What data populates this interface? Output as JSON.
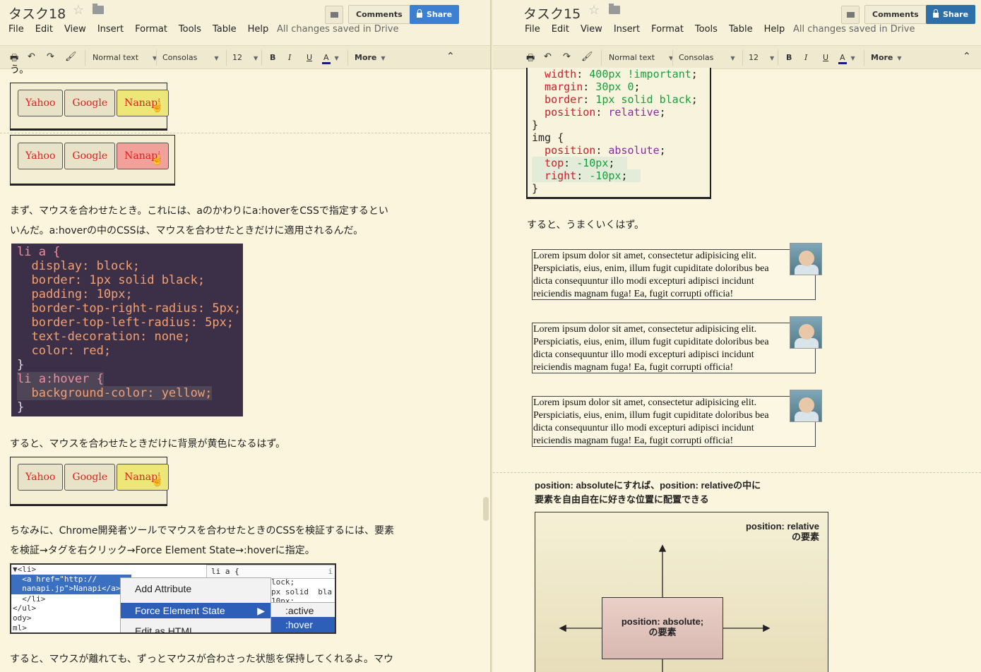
{
  "left": {
    "title": "タスク18",
    "menu": [
      "File",
      "Edit",
      "View",
      "Insert",
      "Format",
      "Tools",
      "Table",
      "Help"
    ],
    "saved": "All changes saved in Drive",
    "comments": "Comments",
    "share": "Share",
    "toolbar": {
      "style": "Normal text",
      "font": "Consolas",
      "size": "12",
      "bold": "B",
      "italic": "I",
      "underline": "U",
      "fontcolor": "A",
      "more": "More"
    },
    "nav_labels": [
      "Yahoo",
      "Google",
      "Nanapi"
    ],
    "para_top": "う。",
    "para1_line1": "まず、マウスを合わせたとき。これには、aのかわりにa:hoverをCSSで指定するとい",
    "para1_line2": "いんだ。a:hoverの中のCSSは、マウスを合わせたときだけに適用されるんだ。",
    "code": [
      "li a {",
      "  display: block;",
      "  border: 1px solid black;",
      "  padding: 10px;",
      "  border-top-right-radius: 5px;",
      "  border-top-left-radius: 5px;",
      "  text-decoration: none;",
      "  color: red;",
      "}",
      "li a:hover {",
      "  background-color: yellow;",
      "}"
    ],
    "para2": "すると、マウスを合わせたときだけに背景が黄色になるはず。",
    "para3_line1": "ちなみに、Chrome開発者ツールでマウスを合わせたときのCSSを検証するには、要素",
    "para3_line2": "を検証→タグを右クリック→Force Element State→:hoverに指定。",
    "devtools": {
      "lines": [
        "▼<li>",
        "  <a href=\"http://",
        "  nanapi.jp\">Nanapi</a>",
        "  </li>",
        "</ul>",
        "ody>",
        "ml>"
      ],
      "styles_head": "li a {",
      "styles_lines": [
        "lock;",
        "px solid  bla",
        "10px;"
      ],
      "context_menu": [
        "Add Attribute",
        "Force Element State",
        "Edit as HTML"
      ],
      "submenu": [
        ":active",
        ":hover"
      ],
      "corner": "i"
    },
    "para4": "すると、マウスが離れても、ずっとマウスが合わさった状態を保持してくれるよ。マウ"
  },
  "right": {
    "title": "タスク15",
    "menu": [
      "File",
      "Edit",
      "View",
      "Insert",
      "Format",
      "Tools",
      "Table",
      "Help"
    ],
    "saved": "All changes saved in Drive",
    "comments": "Comments",
    "share": "Share",
    "toolbar": {
      "style": "Normal text",
      "font": "Consolas",
      "size": "12",
      "bold": "B",
      "italic": "I",
      "underline": "U",
      "fontcolor": "A",
      "more": "More"
    },
    "code": [
      {
        "p": "  width",
        "v": " 400px !important",
        "kind": "prop"
      },
      {
        "p": "  margin",
        "v": " 30px 0",
        "kind": "prop"
      },
      {
        "p": "  border",
        "v": " 1px solid black",
        "kind": "prop"
      },
      {
        "p": "  position",
        "v": " relative",
        "kind": "prop"
      },
      {
        "p": "}",
        "v": "",
        "kind": "plain"
      },
      {
        "p": "img {",
        "v": "",
        "kind": "sel"
      },
      {
        "p": "  position",
        "v": " absolute",
        "kind": "prop"
      },
      {
        "p": "  top",
        "v": " -10px",
        "kind": "prop"
      },
      {
        "p": "  right",
        "v": " -10px",
        "kind": "prop"
      },
      {
        "p": "}",
        "v": "",
        "kind": "plain"
      }
    ],
    "para1": "すると、うまくいくはず。",
    "lorem": [
      "Lorem ipsum dolor sit amet, consectetur adipisicing elit.",
      "Perspiciatis, eius, enim, illum fugit cupiditate doloribus bea",
      "dicta consequuntur illo modi excepturi adipisci incidunt",
      "reiciendis magnam fuga! Ea, fugit corrupti officia!"
    ],
    "diagram_caption_1": "position: absoluteにすれば、position: relativeの中に",
    "diagram_caption_2": "要素を自由自在に好きな位置に配置できる",
    "relative_label_1": "position: relative",
    "relative_label_2": "の要素",
    "absolute_label_1": "position: absolute;",
    "absolute_label_2": "の要素"
  }
}
